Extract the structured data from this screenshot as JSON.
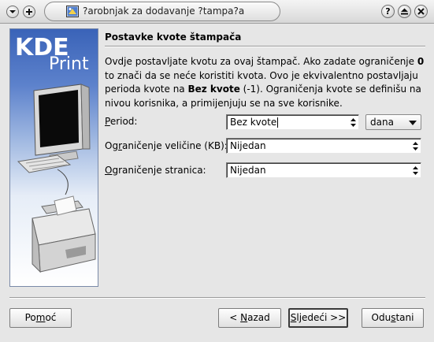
{
  "window": {
    "title": "?arobnjak za dodavanje ?tampa?a",
    "title_icon": "printer-wizard-icon",
    "controls": {
      "help": "?",
      "shade": "shade-icon",
      "close": "close-icon"
    }
  },
  "side_panel": {
    "kde_text": "KDE",
    "print_text": "Print"
  },
  "page": {
    "heading": "Postavke kvote štampača",
    "description": {
      "part1": "Ovdje postavljate kvotu za ovaj štampač. Ako zadate ograničenje ",
      "bold1": "0",
      "part2": " to znači da se neće koristiti kvota. Ovo je ekvivalentno postavljaju perioda kvote na ",
      "bold2": "Bez kvote",
      "part3": " (-1). Ograničenja kvote se definišu na nivou korisnika, a primijenjuju se na sve korisnike."
    },
    "fields": {
      "period": {
        "label_first": "P",
        "label_rest": "eriod:",
        "value": "Bez kvote",
        "unit_value": "dana"
      },
      "size_limit": {
        "label_pre": "Og",
        "label_ul": "r",
        "label_post": "aničenje veličine (KB):",
        "value": "Nijedan"
      },
      "page_limit": {
        "label_first": "O",
        "label_rest": "graničenje stranica:",
        "value": "Nijedan"
      }
    }
  },
  "buttons": {
    "help": {
      "pre": "Po",
      "ul": "m",
      "post": "oć"
    },
    "back": {
      "pre": "< ",
      "ul": "N",
      "post": "azad"
    },
    "next": {
      "pre": "",
      "ul": "S",
      "post": "ljedeći >>"
    },
    "cancel": {
      "pre": "Odu",
      "ul": "s",
      "post": "tani"
    }
  }
}
